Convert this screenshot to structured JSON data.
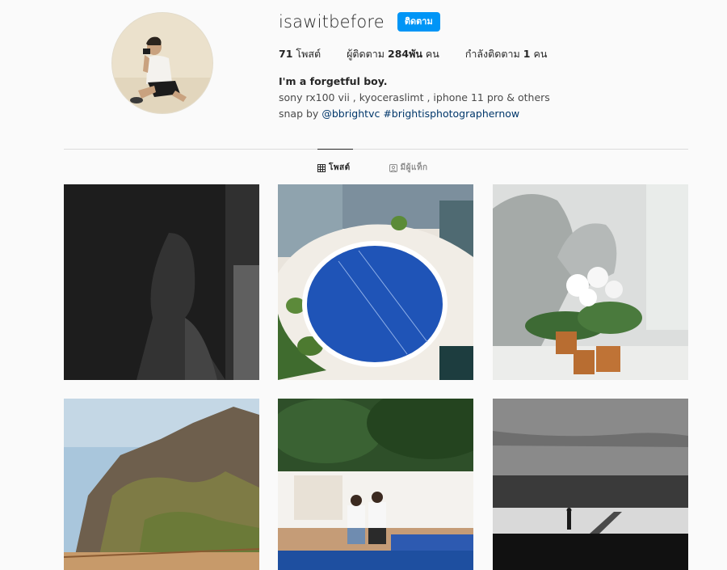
{
  "profile": {
    "username": "isawitbefore",
    "follow_label": "ติดตาม",
    "stats": {
      "posts_count": "71",
      "posts_label": "โพสต์",
      "followers_prefix": "ผู้ติดตาม",
      "followers_count": "284พัน",
      "followers_suffix": "คน",
      "following_prefix": "กำลังติดตาม",
      "following_count": "1",
      "following_suffix": "คน"
    },
    "bio": {
      "name": "I'm a forgetful boy.",
      "line1": "sony rx100 vii , kyoceraslimt , iphone 11 pro & others",
      "snap_prefix": "snap by",
      "mention": "@bbrightvc",
      "hashtag": "#brightisphotographernow"
    }
  },
  "tabs": [
    {
      "label": "โพสต์",
      "icon": "grid-icon",
      "active": true
    },
    {
      "label": "มีผู้แท็ก",
      "icon": "tag-user-icon",
      "active": false
    }
  ],
  "posts": [
    {
      "name": "bw-portrait-window-photo"
    },
    {
      "name": "swimming-pool-aerial-photo"
    },
    {
      "name": "flowers-and-shadow-photo"
    },
    {
      "name": "mountain-cliff-photo"
    },
    {
      "name": "couple-poolside-photo"
    },
    {
      "name": "bw-tunnel-photo"
    }
  ],
  "colors": {
    "follow_button": "#0095f6",
    "link": "#00376b",
    "background": "#fafafa"
  }
}
